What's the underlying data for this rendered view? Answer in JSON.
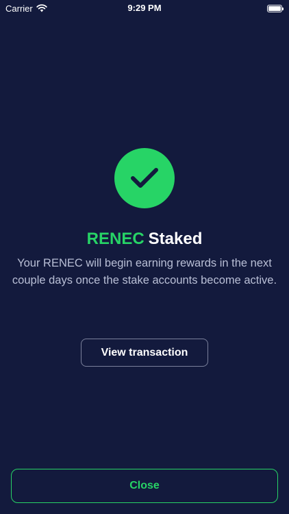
{
  "status_bar": {
    "carrier": "Carrier",
    "time": "9:29 PM"
  },
  "icons": {
    "success": "checkmark-icon",
    "wifi": "wifi-icon",
    "battery": "battery-icon"
  },
  "colors": {
    "background": "#131a3d",
    "accent": "#27d466",
    "muted_text": "#b9bfd6",
    "outline": "#7b819c"
  },
  "success": {
    "token": "RENEC",
    "title_rest": "Staked",
    "description": "Your RENEC will begin earning rewards in the next couple days once the stake accounts become active."
  },
  "actions": {
    "view_transaction_label": "View transaction",
    "close_label": "Close"
  },
  "battery_level": 1.0
}
